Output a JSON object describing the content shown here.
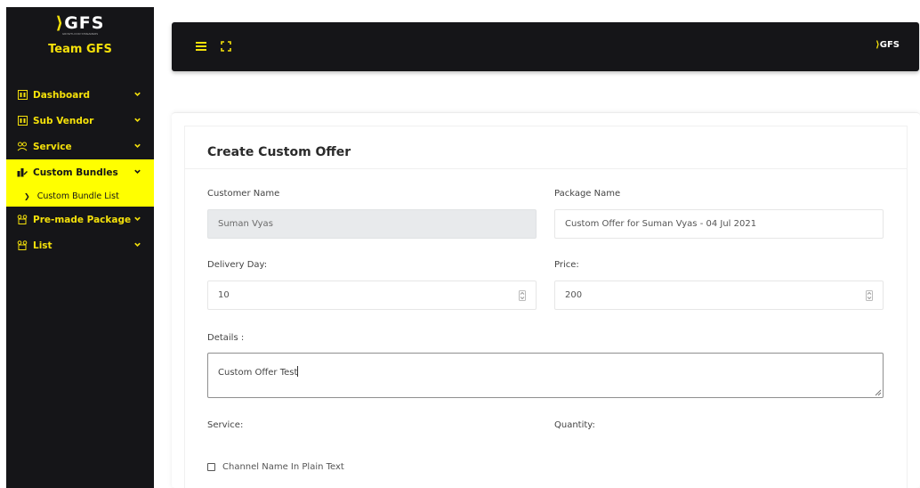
{
  "brand": {
    "logo_text": "GFS",
    "tagline": "GROWTH FOR STREAMERS",
    "team_name": "Team GFS"
  },
  "sidebar": {
    "items": [
      {
        "label": "Dashboard",
        "icon": "dashboard-icon"
      },
      {
        "label": "Sub Vendor",
        "icon": "sub-vendor-icon"
      },
      {
        "label": "Service",
        "icon": "service-icon"
      },
      {
        "label": "Custom Bundles",
        "icon": "custom-bundles-icon",
        "active": true
      },
      {
        "label": "Pre-made Package",
        "icon": "pre-made-package-icon"
      },
      {
        "label": "List",
        "icon": "list-icon"
      }
    ],
    "submenu": {
      "custom_bundle_list": "Custom Bundle List"
    }
  },
  "topbar": {
    "logo_text": "GFS",
    "icons": [
      "hamburger-menu-icon",
      "fullscreen-icon"
    ]
  },
  "form": {
    "title": "Create Custom Offer",
    "customer_name_label": "Customer Name",
    "customer_name_value": "Suman Vyas",
    "package_name_label": "Package Name",
    "package_name_value": "Custom Offer for Suman Vyas - 04 Jul 2021",
    "delivery_day_label": "Delivery Day:",
    "delivery_day_value": "10",
    "price_label": "Price:",
    "price_value": "200",
    "details_label": "Details :",
    "details_value": "Custom Offer Test",
    "service_label": "Service:",
    "quantity_label": "Quantity:",
    "channel_checkbox_label": "Channel Name In Plain Text",
    "channel_checkbox_checked": false
  },
  "colors": {
    "accent_yellow": "#ffff00",
    "brand_yellow": "#f5e10a",
    "sidebar_bg": "#151518",
    "disabled_field_bg": "#e8eaec"
  }
}
